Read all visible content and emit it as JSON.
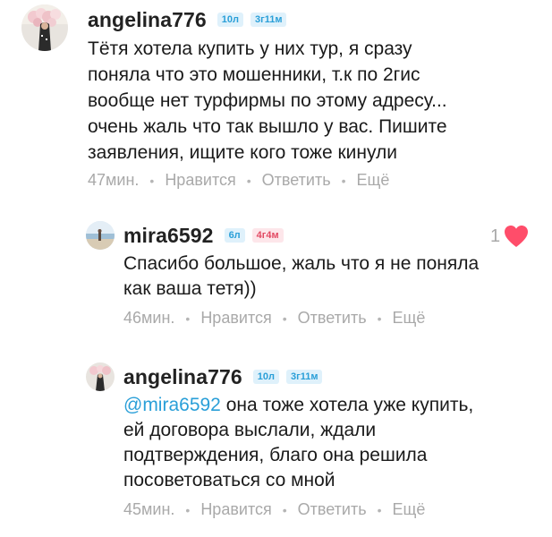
{
  "comments": [
    {
      "username": "angelina776",
      "badge_age": "10л",
      "badge_member": "3г11м",
      "text": "Тётя хотела купить у них тур, я сразу\nпоняла что это мошенники, т.к по 2гис\nвообще нет турфирмы по этому адресу...\nочень жаль что так вышло у вас. Пишите\nзаявления, ищите кого тоже кинули",
      "time": "47мин.",
      "like_label": "Нравится",
      "reply_label": "Ответить",
      "more_label": "Ещё"
    },
    {
      "username": "mira6592",
      "badge_age": "6л",
      "badge_member": "4г4м",
      "text": "Спасибо большое, жаль что я не поняла\nкак ваша тетя))",
      "time": "46мин.",
      "like_label": "Нравится",
      "reply_label": "Ответить",
      "more_label": "Ещё",
      "like_count": "1"
    },
    {
      "username": "angelina776",
      "badge_age": "10л",
      "badge_member": "3г11м",
      "mention": "@mira6592",
      "text": " она тоже хотела уже купить,\nей договора выслали, ждали\nподтверждения,  благо она решила\nпосоветоваться со мной",
      "time": "45мин.",
      "like_label": "Нравится",
      "reply_label": "Ответить",
      "more_label": "Ещё"
    }
  ],
  "colors": {
    "accent": "#2a9fd8",
    "heart": "#ff4d6a",
    "muted": "#a9a9a9"
  }
}
